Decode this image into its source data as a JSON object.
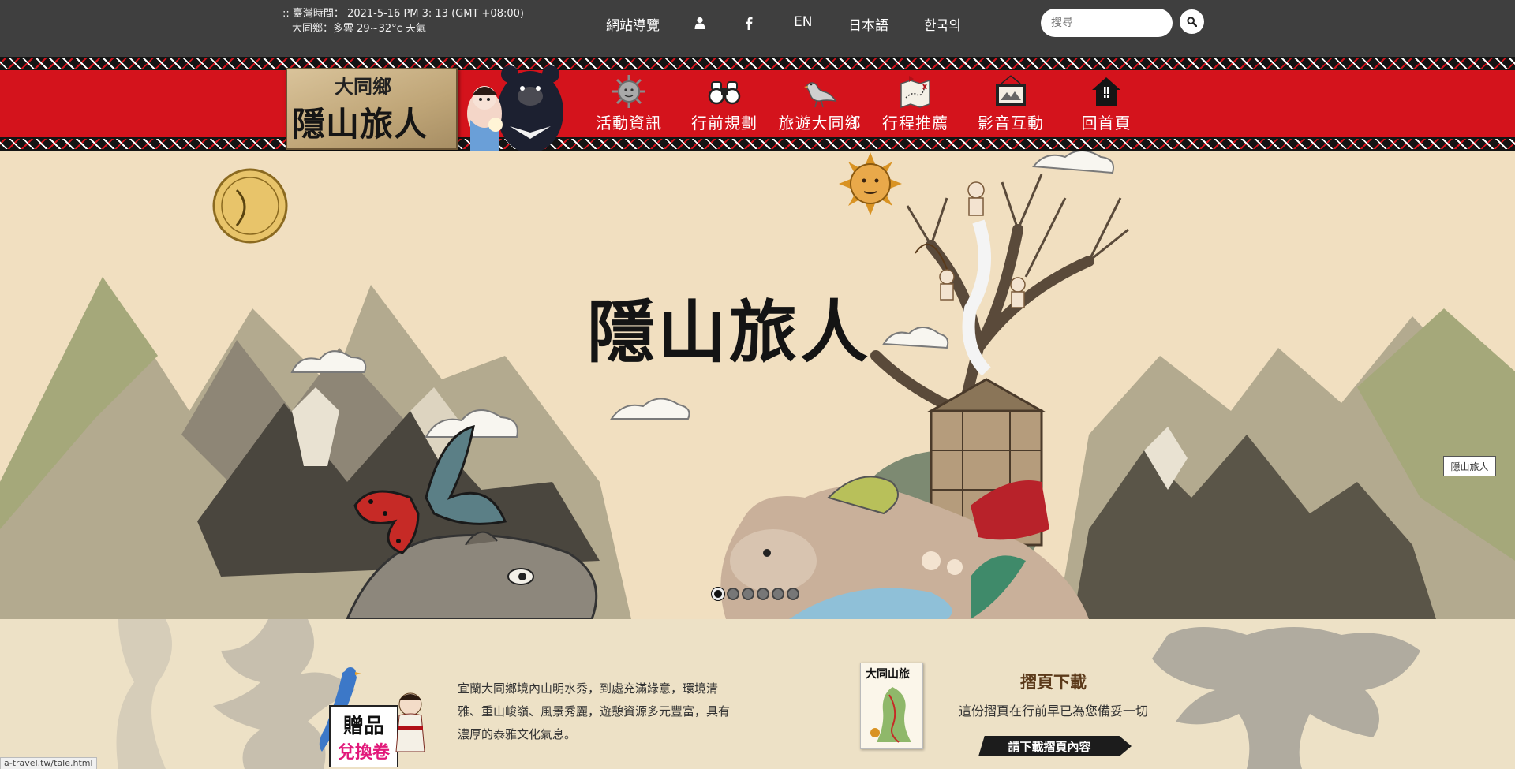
{
  "topbar": {
    "time_label": ":: 臺灣時間：",
    "time_value": "2021-5-16 PM 3: 13 (GMT +08:00)",
    "weather": "大同鄉：多雲  29~32°c 天氣",
    "sitemap": "網站導覽",
    "lang_en": "EN",
    "lang_ja": "日本語",
    "lang_ko": "한국의",
    "search_placeholder": "搜尋"
  },
  "logo": {
    "small": "大同鄉",
    "big": "隱山旅人"
  },
  "nav": [
    {
      "label": "活動資訊",
      "icon": "sun-face-icon"
    },
    {
      "label": "行前規劃",
      "icon": "binoculars-icon"
    },
    {
      "label": "旅遊大同鄉",
      "icon": "bird-icon"
    },
    {
      "label": "行程推薦",
      "icon": "map-icon"
    },
    {
      "label": "影音互動",
      "icon": "picture-frame-icon"
    },
    {
      "label": "回首頁",
      "icon": "home-icon"
    }
  ],
  "hero": {
    "title": "隱山旅人",
    "side_tag": "隱山旅人",
    "slides": 6,
    "active_slide": 1
  },
  "bottom": {
    "gift_line1": "贈品",
    "gift_line2": "兌換卷",
    "intro": "宜蘭大同鄉境內山明水秀，到處充滿綠意，環境清雅、重山峻嶺、風景秀麗，遊憩資源多元豐富，具有濃厚的泰雅文化氣息。",
    "brochure_title": "大同山旅",
    "download_title": "摺頁下載",
    "download_text": "這份摺頁在行前早已為您備妥一切",
    "download_button": "請下載摺頁內容"
  },
  "status_url": "a-travel.tw/tale.html",
  "colors": {
    "topbar_bg": "#3f3f3f",
    "banner_red": "#d4131c",
    "hero_bg": "#f1dfc0",
    "bottom_bg": "#ede1c6",
    "accent_brown": "#5c3a1a"
  }
}
